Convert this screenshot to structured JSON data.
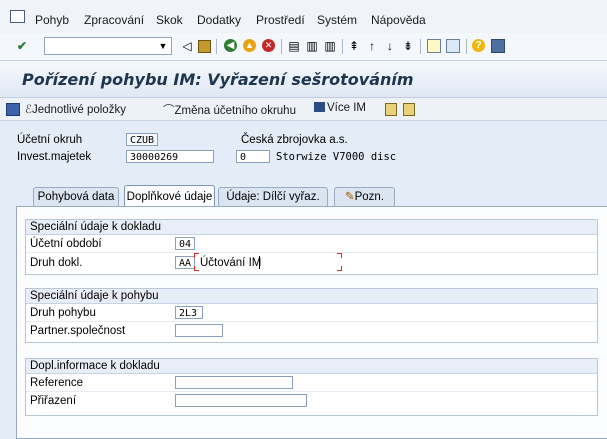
{
  "menu": {
    "items": [
      "Pohyb",
      "Zpracování",
      "Skok",
      "Dodatky",
      "Prostředí",
      "Systém",
      "Nápověda"
    ]
  },
  "toolbar": {
    "command_value": ""
  },
  "page": {
    "title": "Pořízení pohybu IM: Vyřazení sešrotováním"
  },
  "app_toolbar": {
    "single_items": "Jednotlivé položky",
    "change_company_code": "Změna účetního okruhu",
    "more_assets": "Více IM"
  },
  "header": {
    "company_code_label": "Účetní okruh",
    "company_code_value": "CZUB",
    "company_name": "Česká zbrojovka a.s.",
    "asset_label": "Invest.majetek",
    "asset_value": "30000269",
    "subnumber_value": "0",
    "asset_description": "Storwize V7000 disc"
  },
  "tabs": [
    {
      "label": "Pohybová data"
    },
    {
      "label": "Doplňkové údaje"
    },
    {
      "label": "Údaje: Dílčí vyřaz."
    },
    {
      "label": "Pozn."
    }
  ],
  "groups": {
    "doc_special": {
      "title": "Speciální údaje k dokladu",
      "period_label": "Účetní období",
      "period_value": "04",
      "doc_type_label": "Druh dokl.",
      "doc_type_value": "AA",
      "doc_type_text": "Účtování IM"
    },
    "movement_special": {
      "title": "Speciální údaje k pohybu",
      "movement_type_label": "Druh pohybu",
      "movement_type_value": "2L3",
      "partner_label": "Partner.společnost",
      "partner_value": ""
    },
    "doc_extra": {
      "title": "Dopl.informace k dokladu",
      "reference_label": "Reference",
      "reference_value": "",
      "assignment_label": "Přiřazení",
      "assignment_value": ""
    }
  },
  "colors": {
    "background": "#e3ecf7",
    "title_text": "#1f3550",
    "field_border": "#8aa0bd"
  }
}
